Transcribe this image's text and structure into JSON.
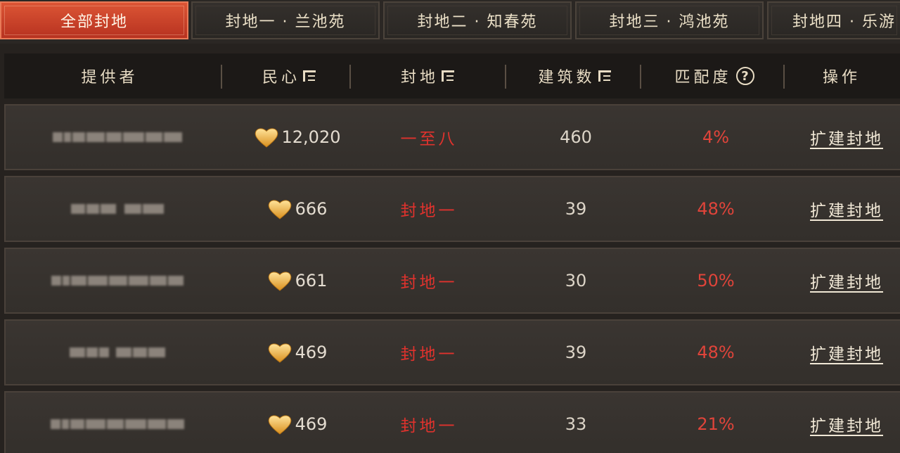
{
  "tabs": [
    {
      "label": "全部封地",
      "active": true
    },
    {
      "label": "封地一 · 兰池苑",
      "active": false
    },
    {
      "label": "封地二 · 知春苑",
      "active": false
    },
    {
      "label": "封地三 · 鸿池苑",
      "active": false
    },
    {
      "label": "封地四 · 乐游",
      "active": false
    }
  ],
  "header": {
    "provider": "提供者",
    "minxin": "民心",
    "fief": "封地",
    "buildings": "建筑数",
    "match": "匹配度",
    "action": "操作",
    "help_symbol": "?"
  },
  "rows": [
    {
      "minxin": "12,020",
      "fief": "一至八",
      "buildings": "460",
      "match": "4%",
      "action": "扩建封地"
    },
    {
      "minxin": "666",
      "fief": "封地一",
      "buildings": "39",
      "match": "48%",
      "action": "扩建封地"
    },
    {
      "minxin": "661",
      "fief": "封地一",
      "buildings": "30",
      "match": "50%",
      "action": "扩建封地"
    },
    {
      "minxin": "469",
      "fief": "封地一",
      "buildings": "39",
      "match": "48%",
      "action": "扩建封地"
    },
    {
      "minxin": "469",
      "fief": "封地一",
      "buildings": "33",
      "match": "21%",
      "action": "扩建封地"
    }
  ],
  "icons": {
    "sort": "sort-filter-icon",
    "help": "help-circle-icon",
    "minxin": "gold-heart-icon"
  },
  "colors": {
    "active_tab": "#c9412a",
    "fief_text": "#e0322d",
    "match_text": "#e0443a",
    "heart_gold": "#f0b84a"
  }
}
